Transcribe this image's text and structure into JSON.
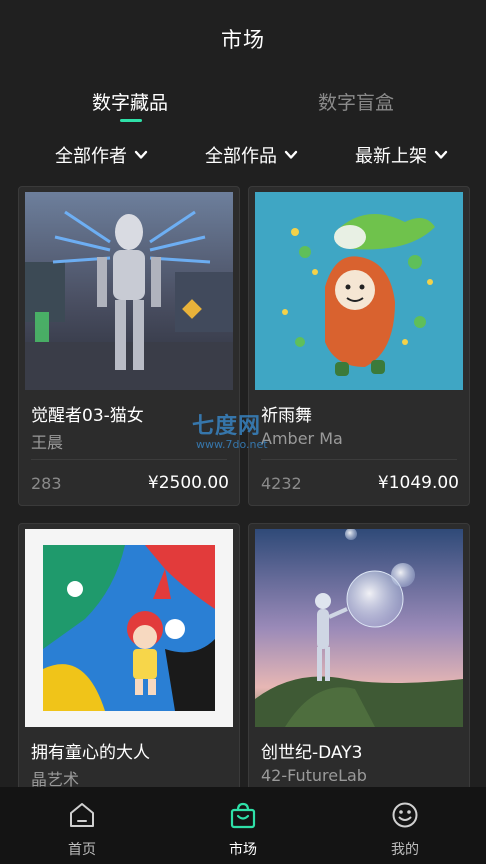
{
  "header": {
    "title": "市场"
  },
  "tabs": [
    {
      "label": "数字藏品",
      "active": true
    },
    {
      "label": "数字盲盒",
      "active": false
    }
  ],
  "filters": [
    {
      "label": "全部作者"
    },
    {
      "label": "全部作品"
    },
    {
      "label": "最新上架"
    }
  ],
  "cards": [
    {
      "name": "觉醒者03-猫女",
      "author": "王晨",
      "count": "283",
      "price": "¥2500.00",
      "image_icon": "robot-artwork"
    },
    {
      "name": "祈雨舞",
      "author": "Amber Ma",
      "count": "4232",
      "price": "¥1049.00",
      "image_icon": "rain-dance-artwork"
    },
    {
      "name": "拥有童心的大人",
      "author": "晶艺术",
      "image_icon": "child-heart-artwork"
    },
    {
      "name": "创世纪-DAY3",
      "author": "42-FutureLab",
      "image_icon": "genesis-artwork"
    }
  ],
  "watermark": {
    "main": "七度网",
    "url": "www.7do.net"
  },
  "bottom_nav": [
    {
      "label": "首页",
      "icon": "home-icon",
      "active": false
    },
    {
      "label": "市场",
      "icon": "bag-icon",
      "active": true
    },
    {
      "label": "我的",
      "icon": "smiley-icon",
      "active": false
    }
  ],
  "colors": {
    "accent": "#2fe0a8",
    "background": "#202020",
    "card": "#2c2c2c",
    "nav": "#141414"
  }
}
